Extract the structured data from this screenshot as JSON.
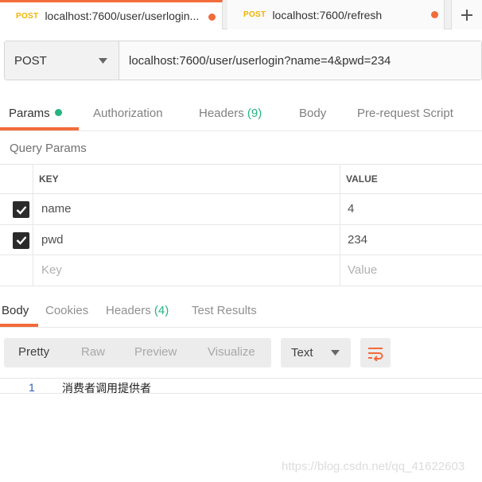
{
  "tabs": [
    {
      "method": "POST",
      "url": "localhost:7600/user/userlogin..."
    },
    {
      "method": "POST",
      "url": "localhost:7600/refresh"
    }
  ],
  "request": {
    "method": "POST",
    "url": "localhost:7600/user/userlogin?name=4&pwd=234"
  },
  "request_tabs": {
    "params": "Params",
    "authorization": "Authorization",
    "headers": "Headers",
    "headers_count": "(9)",
    "body": "Body",
    "prerequest": "Pre-request Script"
  },
  "query_params": {
    "title": "Query Params",
    "key_header": "KEY",
    "value_header": "VALUE",
    "rows": [
      {
        "key": "name",
        "value": "4",
        "checked": true
      },
      {
        "key": "pwd",
        "value": "234",
        "checked": true
      }
    ],
    "key_placeholder": "Key",
    "value_placeholder": "Value"
  },
  "response_tabs": {
    "body": "Body",
    "cookies": "Cookies",
    "headers": "Headers",
    "headers_count": "(4)",
    "test_results": "Test Results"
  },
  "format": {
    "pretty": "Pretty",
    "raw": "Raw",
    "preview": "Preview",
    "visualize": "Visualize",
    "type": "Text"
  },
  "response_body": {
    "line_number": "1",
    "text": "消费者调用提供者"
  },
  "watermark": "https://blog.csdn.net/qq_41622603",
  "colors": {
    "accent": "#f26b3a",
    "green": "#26b47f",
    "method_yellow": "#f0b400"
  }
}
